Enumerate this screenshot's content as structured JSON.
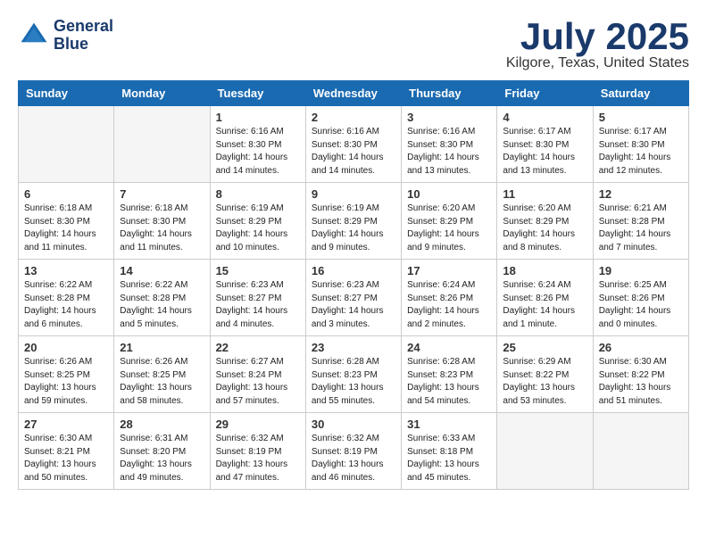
{
  "header": {
    "logo_line1": "General",
    "logo_line2": "Blue",
    "month": "July 2025",
    "location": "Kilgore, Texas, United States"
  },
  "weekdays": [
    "Sunday",
    "Monday",
    "Tuesday",
    "Wednesday",
    "Thursday",
    "Friday",
    "Saturday"
  ],
  "weeks": [
    [
      {
        "day": "",
        "info": ""
      },
      {
        "day": "",
        "info": ""
      },
      {
        "day": "1",
        "info": "Sunrise: 6:16 AM\nSunset: 8:30 PM\nDaylight: 14 hours and 14 minutes."
      },
      {
        "day": "2",
        "info": "Sunrise: 6:16 AM\nSunset: 8:30 PM\nDaylight: 14 hours and 14 minutes."
      },
      {
        "day": "3",
        "info": "Sunrise: 6:16 AM\nSunset: 8:30 PM\nDaylight: 14 hours and 13 minutes."
      },
      {
        "day": "4",
        "info": "Sunrise: 6:17 AM\nSunset: 8:30 PM\nDaylight: 14 hours and 13 minutes."
      },
      {
        "day": "5",
        "info": "Sunrise: 6:17 AM\nSunset: 8:30 PM\nDaylight: 14 hours and 12 minutes."
      }
    ],
    [
      {
        "day": "6",
        "info": "Sunrise: 6:18 AM\nSunset: 8:30 PM\nDaylight: 14 hours and 11 minutes."
      },
      {
        "day": "7",
        "info": "Sunrise: 6:18 AM\nSunset: 8:30 PM\nDaylight: 14 hours and 11 minutes."
      },
      {
        "day": "8",
        "info": "Sunrise: 6:19 AM\nSunset: 8:29 PM\nDaylight: 14 hours and 10 minutes."
      },
      {
        "day": "9",
        "info": "Sunrise: 6:19 AM\nSunset: 8:29 PM\nDaylight: 14 hours and 9 minutes."
      },
      {
        "day": "10",
        "info": "Sunrise: 6:20 AM\nSunset: 8:29 PM\nDaylight: 14 hours and 9 minutes."
      },
      {
        "day": "11",
        "info": "Sunrise: 6:20 AM\nSunset: 8:29 PM\nDaylight: 14 hours and 8 minutes."
      },
      {
        "day": "12",
        "info": "Sunrise: 6:21 AM\nSunset: 8:28 PM\nDaylight: 14 hours and 7 minutes."
      }
    ],
    [
      {
        "day": "13",
        "info": "Sunrise: 6:22 AM\nSunset: 8:28 PM\nDaylight: 14 hours and 6 minutes."
      },
      {
        "day": "14",
        "info": "Sunrise: 6:22 AM\nSunset: 8:28 PM\nDaylight: 14 hours and 5 minutes."
      },
      {
        "day": "15",
        "info": "Sunrise: 6:23 AM\nSunset: 8:27 PM\nDaylight: 14 hours and 4 minutes."
      },
      {
        "day": "16",
        "info": "Sunrise: 6:23 AM\nSunset: 8:27 PM\nDaylight: 14 hours and 3 minutes."
      },
      {
        "day": "17",
        "info": "Sunrise: 6:24 AM\nSunset: 8:26 PM\nDaylight: 14 hours and 2 minutes."
      },
      {
        "day": "18",
        "info": "Sunrise: 6:24 AM\nSunset: 8:26 PM\nDaylight: 14 hours and 1 minute."
      },
      {
        "day": "19",
        "info": "Sunrise: 6:25 AM\nSunset: 8:26 PM\nDaylight: 14 hours and 0 minutes."
      }
    ],
    [
      {
        "day": "20",
        "info": "Sunrise: 6:26 AM\nSunset: 8:25 PM\nDaylight: 13 hours and 59 minutes."
      },
      {
        "day": "21",
        "info": "Sunrise: 6:26 AM\nSunset: 8:25 PM\nDaylight: 13 hours and 58 minutes."
      },
      {
        "day": "22",
        "info": "Sunrise: 6:27 AM\nSunset: 8:24 PM\nDaylight: 13 hours and 57 minutes."
      },
      {
        "day": "23",
        "info": "Sunrise: 6:28 AM\nSunset: 8:23 PM\nDaylight: 13 hours and 55 minutes."
      },
      {
        "day": "24",
        "info": "Sunrise: 6:28 AM\nSunset: 8:23 PM\nDaylight: 13 hours and 54 minutes."
      },
      {
        "day": "25",
        "info": "Sunrise: 6:29 AM\nSunset: 8:22 PM\nDaylight: 13 hours and 53 minutes."
      },
      {
        "day": "26",
        "info": "Sunrise: 6:30 AM\nSunset: 8:22 PM\nDaylight: 13 hours and 51 minutes."
      }
    ],
    [
      {
        "day": "27",
        "info": "Sunrise: 6:30 AM\nSunset: 8:21 PM\nDaylight: 13 hours and 50 minutes."
      },
      {
        "day": "28",
        "info": "Sunrise: 6:31 AM\nSunset: 8:20 PM\nDaylight: 13 hours and 49 minutes."
      },
      {
        "day": "29",
        "info": "Sunrise: 6:32 AM\nSunset: 8:19 PM\nDaylight: 13 hours and 47 minutes."
      },
      {
        "day": "30",
        "info": "Sunrise: 6:32 AM\nSunset: 8:19 PM\nDaylight: 13 hours and 46 minutes."
      },
      {
        "day": "31",
        "info": "Sunrise: 6:33 AM\nSunset: 8:18 PM\nDaylight: 13 hours and 45 minutes."
      },
      {
        "day": "",
        "info": ""
      },
      {
        "day": "",
        "info": ""
      }
    ]
  ]
}
